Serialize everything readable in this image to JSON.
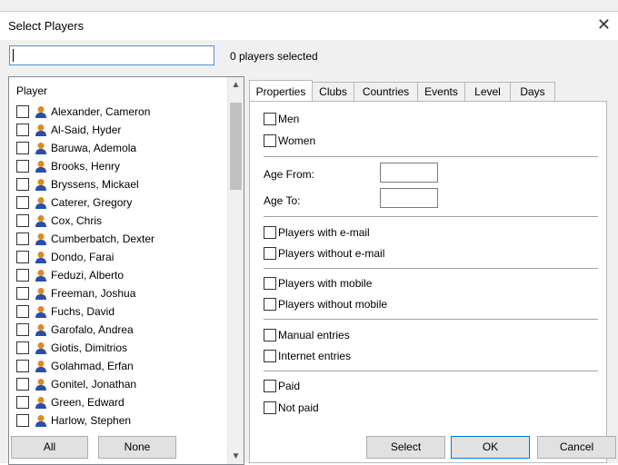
{
  "dialog": {
    "title": "Select Players"
  },
  "search": {
    "value": "",
    "status": "0 players selected"
  },
  "list": {
    "header": "Player",
    "players": [
      "Alexander, Cameron",
      "Al-Said, Hyder",
      "Baruwa, Ademola",
      "Brooks, Henry",
      "Bryssens, Mickael",
      "Caterer, Gregory",
      "Cox, Chris",
      "Cumberbatch, Dexter",
      "Dondo, Farai",
      "Feduzi, Alberto",
      "Freeman, Joshua",
      "Fuchs, David",
      "Garofalo, Andrea",
      "Giotis, Dimitrios",
      "Golahmad, Erfan",
      "Gonitel, Jonathan",
      "Green, Edward",
      "Harlow, Stephen"
    ]
  },
  "tabs": [
    "Properties",
    "Clubs",
    "Countries",
    "Events",
    "Level",
    "Days"
  ],
  "properties": {
    "men": "Men",
    "women": "Women",
    "age_from": "Age From:",
    "age_to": "Age To:",
    "with_email": "Players with e-mail",
    "without_email": "Players without e-mail",
    "with_mobile": "Players with mobile",
    "without_mobile": "Players without mobile",
    "manual": "Manual entries",
    "internet": "Internet entries",
    "paid": "Paid",
    "not_paid": "Not paid"
  },
  "buttons": {
    "all": "All",
    "none": "None",
    "select": "Select",
    "ok": "OK",
    "cancel": "Cancel"
  },
  "colors": {
    "accent": "#0078d7",
    "icon_head": "#d98a2b",
    "icon_body": "#2b4fa8"
  }
}
